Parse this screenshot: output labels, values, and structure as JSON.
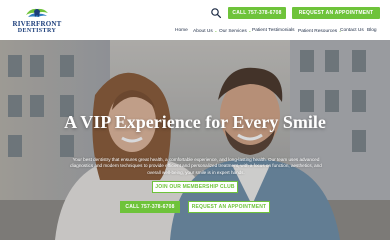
{
  "logo": {
    "line1": "RIVERFRONT",
    "line2": "DENTISTRY"
  },
  "header": {
    "search_icon": "search-icon",
    "call_button": "CALL 757-378-6708",
    "appointment_button": "REQUEST AN APPOINTMENT"
  },
  "nav": {
    "items": [
      {
        "label": "Home",
        "has_dropdown": false
      },
      {
        "label": "About Us",
        "has_dropdown": true
      },
      {
        "label": "Our Services",
        "has_dropdown": true
      },
      {
        "label": "Patient Testimonials",
        "has_dropdown": false
      },
      {
        "label": "Patient Resources",
        "has_dropdown": true
      },
      {
        "label": "Contact Us",
        "has_dropdown": false
      },
      {
        "label": "Blog",
        "has_dropdown": false
      }
    ],
    "caret": "⌄"
  },
  "hero": {
    "title": "A VIP Experience for Every Smile",
    "description": "Your best dentistry that ensures great health, a comfortable experience, and long-lasting health. Our team uses advanced diagnostics and modern techniques to provide efficient and personalized treatment, with a focus on function, aesthetics, and overall well-being, your smile is in expert hands.",
    "membership_button": "JOIN OUR MEMBERSHIP CLUB",
    "call_button": "CALL 757-378-6708",
    "appointment_button": "REQUEST AN APPOINTMENT"
  },
  "colors": {
    "accent_green": "#6ec33a",
    "brand_navy": "#1b3d7a"
  }
}
